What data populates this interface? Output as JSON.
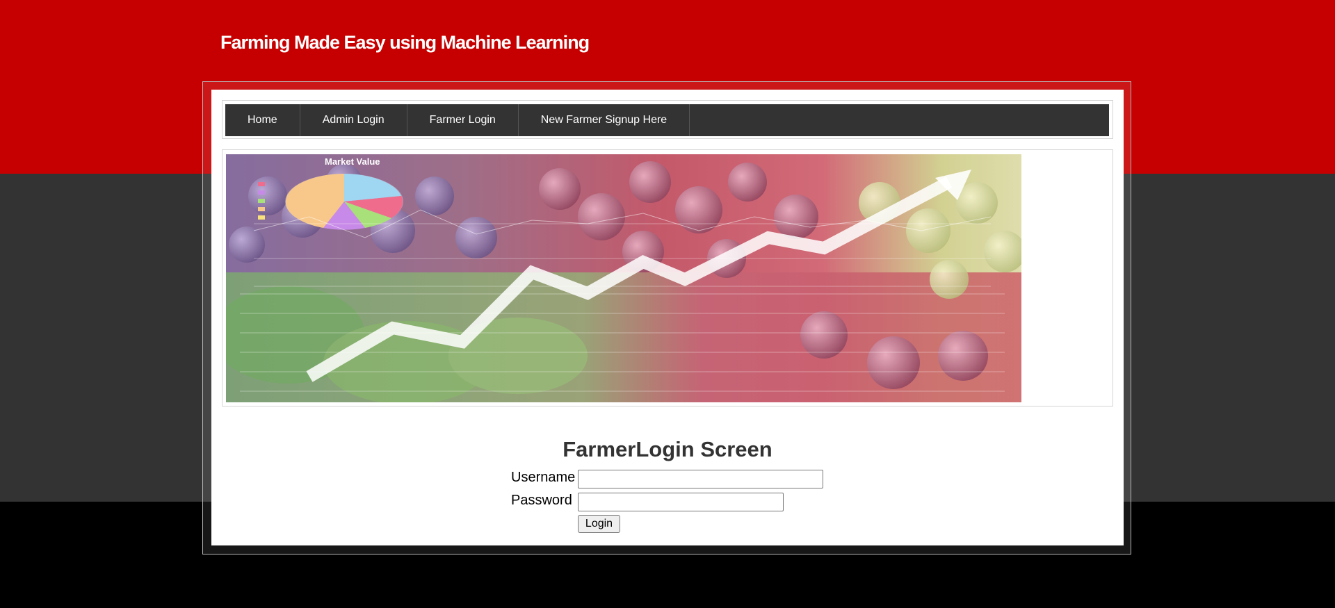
{
  "header": {
    "title": "Farming Made Easy using Machine Learning"
  },
  "nav": {
    "items": [
      {
        "label": "Home"
      },
      {
        "label": "Admin Login"
      },
      {
        "label": "Farmer Login"
      },
      {
        "label": "New Farmer Signup Here"
      }
    ]
  },
  "banner": {
    "chart_title": "Market Value"
  },
  "login": {
    "heading": "FarmerLogin Screen",
    "username_label": "Username",
    "username_value": "",
    "password_label": "Password",
    "password_value": "",
    "button_label": "Login"
  },
  "colors": {
    "header_red": "#c60000",
    "dark_band": "#333333",
    "nav_bar": "#333333",
    "panel": "#ffffff"
  }
}
